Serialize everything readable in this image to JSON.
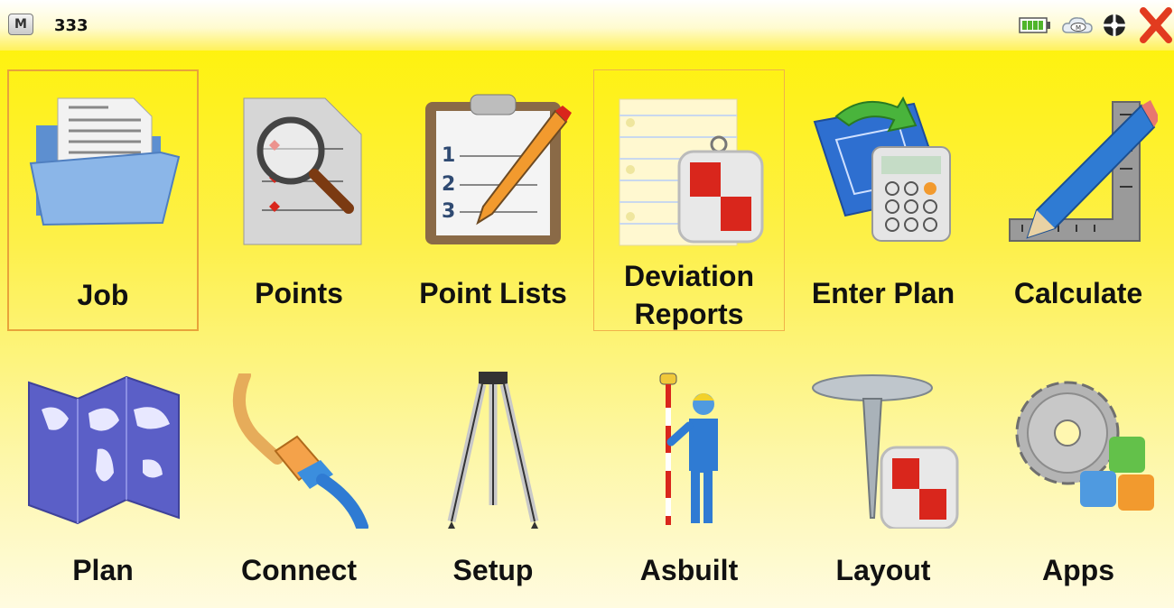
{
  "header": {
    "menu_letter": "M",
    "job_name": "333",
    "status_icons": [
      "battery-icon",
      "cloud-icon",
      "satellite-icon",
      "close-icon"
    ]
  },
  "tiles_row1": [
    {
      "id": "job",
      "label": "Job",
      "icon": "folder-icon",
      "selected": true
    },
    {
      "id": "points",
      "label": "Points",
      "icon": "magnifier-document-icon"
    },
    {
      "id": "point-lists",
      "label": "Point Lists",
      "icon": "clipboard-list-icon"
    },
    {
      "id": "deviation-reports",
      "label_line1": "Deviation",
      "label_line2": "Reports",
      "icon": "notepad-target-icon",
      "hover": true
    },
    {
      "id": "enter-plan",
      "label": "Enter Plan",
      "icon": "blueprint-calculator-icon"
    },
    {
      "id": "calculate",
      "label": "Calculate",
      "icon": "pencil-square-icon"
    }
  ],
  "tiles_row2": [
    {
      "id": "plan",
      "label": "Plan",
      "icon": "world-map-icon"
    },
    {
      "id": "connect",
      "label": "Connect",
      "icon": "cable-plug-icon"
    },
    {
      "id": "setup",
      "label": "Setup",
      "icon": "tripod-icon"
    },
    {
      "id": "asbuilt",
      "label": "Asbuilt",
      "icon": "surveyor-icon"
    },
    {
      "id": "layout",
      "label": "Layout",
      "icon": "stake-target-icon"
    },
    {
      "id": "apps",
      "label": "Apps",
      "icon": "gear-blocks-icon"
    }
  ],
  "colors": {
    "accent_border": "#e8a33a",
    "background_top": "#fff200",
    "close_red": "#e23b1f"
  }
}
